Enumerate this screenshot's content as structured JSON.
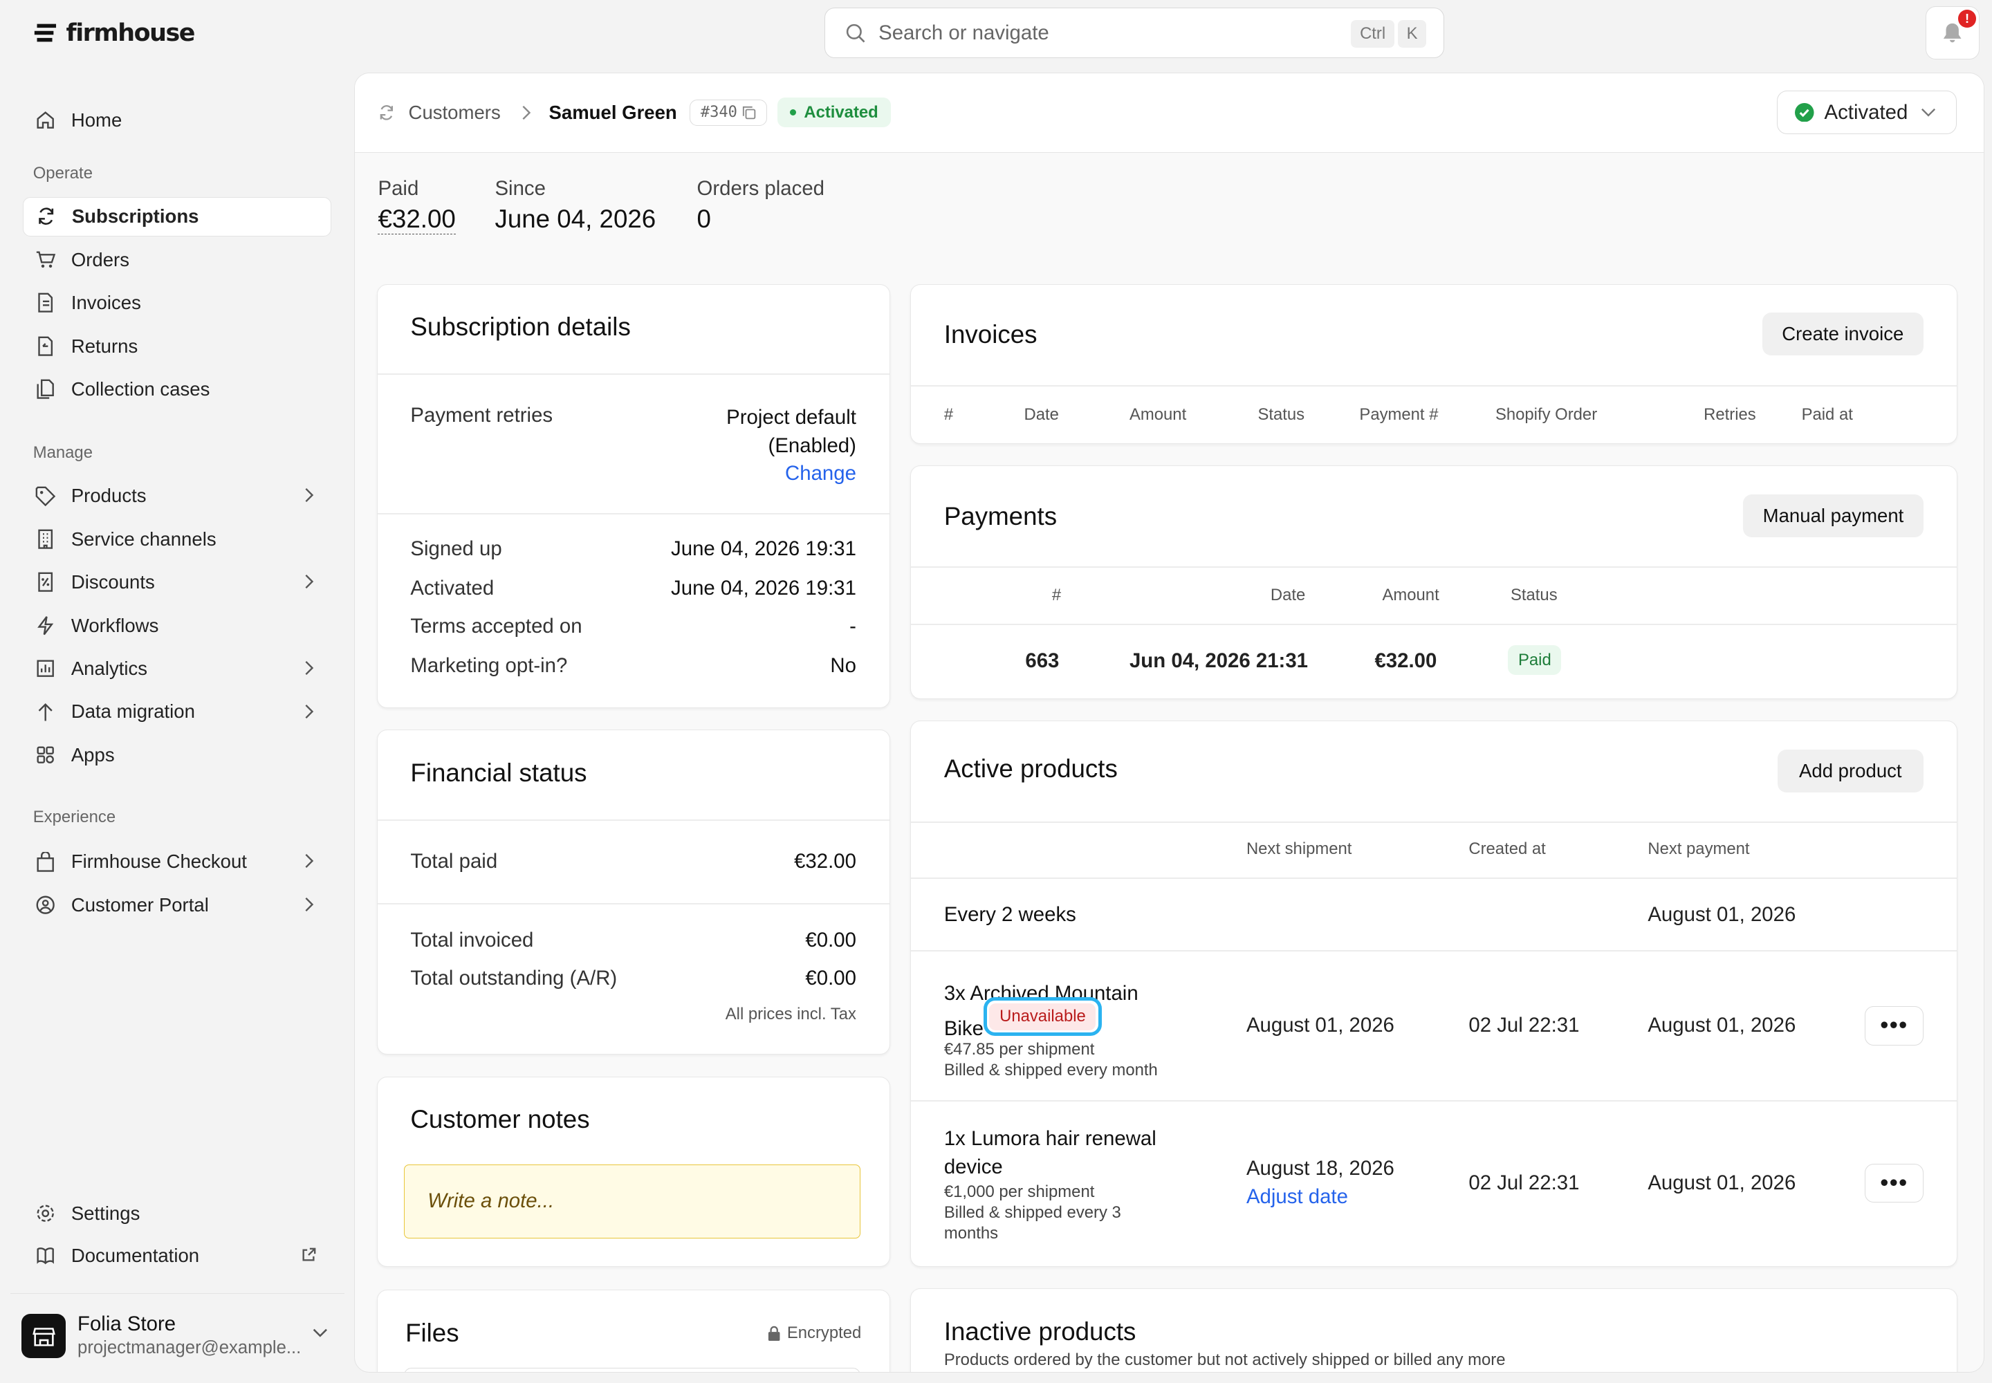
{
  "app": {
    "brand": "firmhouse"
  },
  "sidebar": {
    "home": "Home",
    "sections": {
      "operate": "Operate",
      "manage": "Manage",
      "experience": "Experience"
    },
    "operate": [
      "Subscriptions",
      "Orders",
      "Invoices",
      "Returns",
      "Collection cases"
    ],
    "manage": [
      "Products",
      "Service channels",
      "Discounts",
      "Workflows",
      "Analytics",
      "Data migration",
      "Apps"
    ],
    "experience": [
      "Firmhouse Checkout",
      "Customer Portal"
    ],
    "settings": "Settings",
    "documentation": "Documentation",
    "store": {
      "name": "Folia Store",
      "email": "projectmanager@example..."
    }
  },
  "search": {
    "placeholder": "Search or navigate",
    "ctrl": "Ctrl",
    "k": "K"
  },
  "notifications": {
    "badge": "!"
  },
  "header": {
    "crumb": "Customers",
    "name": "Samuel Green",
    "id": "#340",
    "status": "Activated",
    "status_dropdown": "Activated"
  },
  "stats": [
    {
      "label": "Paid",
      "value": "€32.00"
    },
    {
      "label": "Since",
      "value": "June 04, 2026"
    },
    {
      "label": "Orders placed",
      "value": "0"
    }
  ],
  "subscription": {
    "title": "Subscription details",
    "retries_label": "Payment retries",
    "retries_value1": "Project default",
    "retries_value2": "(Enabled)",
    "change": "Change",
    "rows": [
      {
        "label": "Signed up",
        "value": "June 04, 2026 19:31"
      },
      {
        "label": "Activated",
        "value": "June 04, 2026 19:31"
      },
      {
        "label": "Terms accepted on",
        "value": "-"
      },
      {
        "label": "Marketing opt-in?",
        "value": "No"
      }
    ]
  },
  "financial": {
    "title": "Financial status",
    "total_paid_label": "Total paid",
    "total_paid": "€32.00",
    "invoiced_label": "Total invoiced",
    "invoiced": "€0.00",
    "outstanding_label": "Total outstanding (A/R)",
    "outstanding": "€0.00",
    "tax_note": "All prices incl. Tax"
  },
  "notes": {
    "title": "Customer notes",
    "placeholder": "Write a note..."
  },
  "files": {
    "title": "Files",
    "encrypted": "Encrypted"
  },
  "invoices": {
    "title": "Invoices",
    "button": "Create invoice",
    "columns": [
      "#",
      "Date",
      "Amount",
      "Status",
      "Payment #",
      "Shopify Order",
      "Retries",
      "Paid at"
    ]
  },
  "payments": {
    "title": "Payments",
    "button": "Manual payment",
    "columns": [
      "#",
      "Date",
      "Amount",
      "Status"
    ],
    "rows": [
      {
        "id": "663",
        "date": "Jun 04, 2026 21:31",
        "amount": "€32.00",
        "status": "Paid"
      }
    ]
  },
  "active": {
    "title": "Active products",
    "button": "Add product",
    "columns": [
      "Next shipment",
      "Created at",
      "Next payment"
    ],
    "group": {
      "label": "Every 2 weeks",
      "next_payment": "August 01, 2026"
    },
    "items": [
      {
        "name1": "3x Archived Mountain",
        "name2": "Bike",
        "badge": "Unavailable",
        "price": "€47.85 per shipment",
        "billing": "Billed & shipped every month",
        "next_shipment": "August 01, 2026",
        "created": "02 Jul 22:31",
        "next_payment": "August 01, 2026"
      },
      {
        "name1": "1x Lumora hair renewal",
        "name2": "device",
        "price": "€1,000 per shipment",
        "billing1": "Billed & shipped every 3",
        "billing2": "months",
        "next_shipment": "August 18, 2026",
        "adjust": "Adjust date",
        "created": "02 Jul 22:31",
        "next_payment": "August 01, 2026"
      }
    ]
  },
  "inactive": {
    "title": "Inactive products",
    "subtitle": "Products ordered by the customer but not actively shipped or billed any more"
  }
}
